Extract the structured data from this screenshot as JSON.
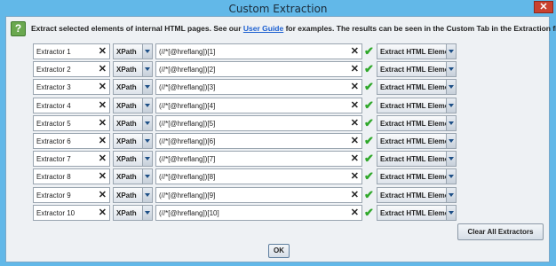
{
  "window": {
    "title": "Custom Extraction",
    "close_label": "✕"
  },
  "help": {
    "icon_label": "?"
  },
  "intro": {
    "before": "Extract selected elements of internal HTML pages. See our ",
    "link": "User Guide",
    "after": " for examples. The results can be seen in the Custom Tab in the Extraction filter."
  },
  "extractors": [
    {
      "name": "Extractor 1",
      "type": "XPath",
      "expression": "(//*[@hreflang])[1]",
      "mode": "Extract HTML Element"
    },
    {
      "name": "Extractor 2",
      "type": "XPath",
      "expression": "(//*[@hreflang])[2]",
      "mode": "Extract HTML Element"
    },
    {
      "name": "Extractor 3",
      "type": "XPath",
      "expression": "(//*[@hreflang])[3]",
      "mode": "Extract HTML Element"
    },
    {
      "name": "Extractor 4",
      "type": "XPath",
      "expression": "(//*[@hreflang])[4]",
      "mode": "Extract HTML Element"
    },
    {
      "name": "Extractor 5",
      "type": "XPath",
      "expression": "(//*[@hreflang])[5]",
      "mode": "Extract HTML Element"
    },
    {
      "name": "Extractor 6",
      "type": "XPath",
      "expression": "(//*[@hreflang])[6]",
      "mode": "Extract HTML Element"
    },
    {
      "name": "Extractor 7",
      "type": "XPath",
      "expression": "(//*[@hreflang])[7]",
      "mode": "Extract HTML Element"
    },
    {
      "name": "Extractor 8",
      "type": "XPath",
      "expression": "(//*[@hreflang])[8]",
      "mode": "Extract HTML Element"
    },
    {
      "name": "Extractor 9",
      "type": "XPath",
      "expression": "(//*[@hreflang])[9]",
      "mode": "Extract HTML Element"
    },
    {
      "name": "Extractor 10",
      "type": "XPath",
      "expression": "(//*[@hreflang])[10]",
      "mode": "Extract HTML Element"
    }
  ],
  "field_clear_glyph": "✕",
  "valid_glyph": "✔",
  "buttons": {
    "clear_all": "Clear All Extractors",
    "ok": "OK"
  },
  "colors": {
    "title_bar": "#62b8e8",
    "close_button": "#c9412f",
    "valid_check": "#2fa82a",
    "link": "#1b5fd1"
  }
}
